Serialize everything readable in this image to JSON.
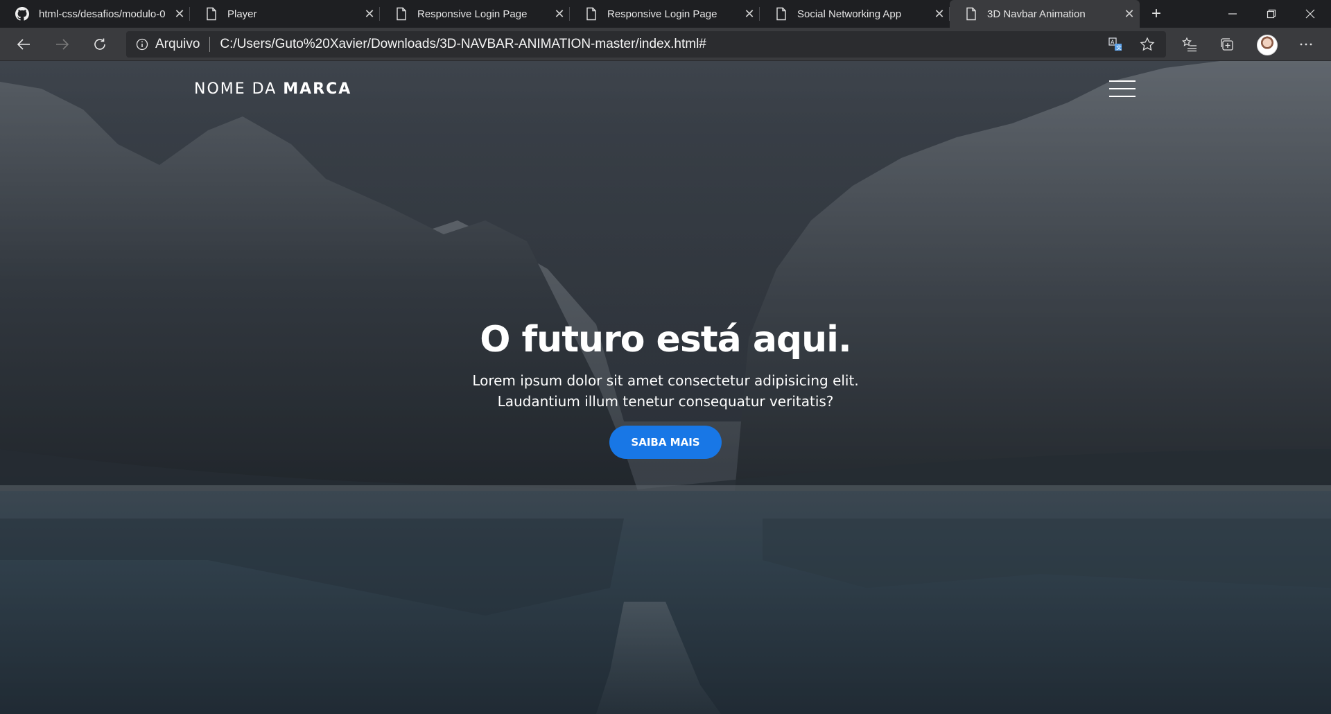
{
  "tabs": [
    {
      "title": "html-css/desafios/modulo-0",
      "icon": "github-icon",
      "active": false
    },
    {
      "title": "Player",
      "icon": "page-icon",
      "active": false
    },
    {
      "title": "Responsive Login Page",
      "icon": "page-icon",
      "active": false
    },
    {
      "title": "Responsive Login Page",
      "icon": "page-icon",
      "active": false
    },
    {
      "title": "Social Networking App",
      "icon": "page-icon",
      "active": false
    },
    {
      "title": "3D Navbar Animation",
      "icon": "page-icon",
      "active": true
    }
  ],
  "tab_close_glyph": "✕",
  "new_tab_glyph": "+",
  "addressbar": {
    "site_label": "Arquivo",
    "url": "C:/Users/Guto%20Xavier/Downloads/3D-NAVBAR-ANIMATION-master/index.html#"
  },
  "page": {
    "brand_light": "NOME DA ",
    "brand_bold": "MARCA",
    "hero_title": "O futuro está aqui.",
    "hero_line1": "Lorem ipsum dolor sit amet consectetur adipisicing elit.",
    "hero_line2": "Laudantium illum tenetur consequatur veritatis?",
    "cta_label": "SAIBA MAIS"
  },
  "colors": {
    "cta": "#1877e6",
    "tabstrip": "#1e1f22",
    "toolbar": "#3a3b3e"
  }
}
